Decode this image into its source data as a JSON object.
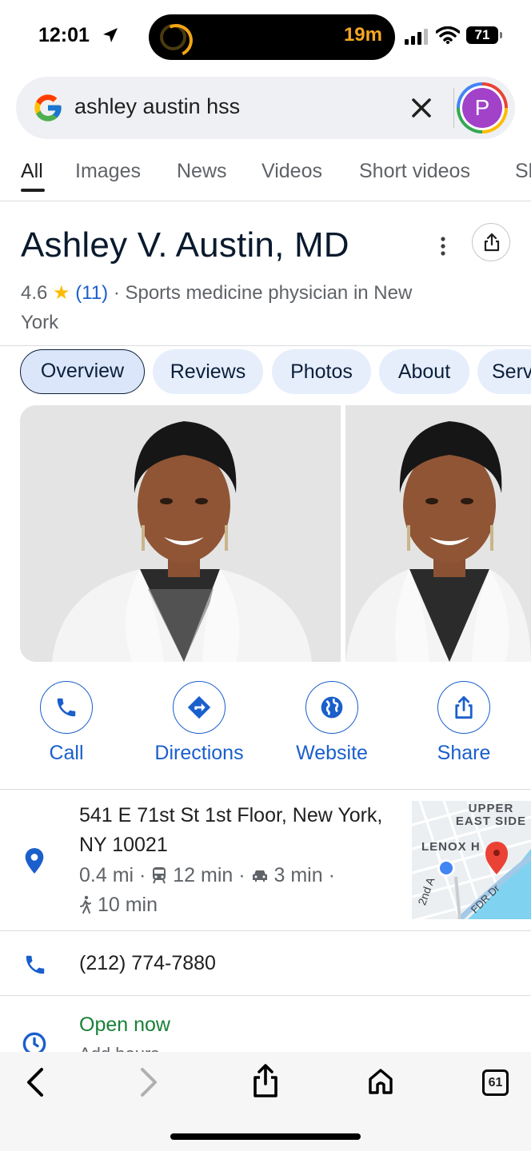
{
  "status_bar": {
    "time": "12:01",
    "timer": "19m",
    "battery": "71"
  },
  "search": {
    "query": "ashley austin hss",
    "avatar_letter": "P"
  },
  "result_tabs": [
    "All",
    "Images",
    "News",
    "Videos",
    "Short videos",
    "Sh"
  ],
  "place": {
    "name": "Ashley V. Austin, MD",
    "rating": "4.6",
    "star": "★",
    "review_count": "(11)",
    "category": "· Sports medicine physician in New York"
  },
  "chips": [
    "Overview",
    "Reviews",
    "Photos",
    "About",
    "Services"
  ],
  "actions": {
    "call": "Call",
    "directions": "Directions",
    "website": "Website",
    "share": "Share"
  },
  "address": {
    "line": "541 E 71st St 1st Floor, New York, NY 10021",
    "distance": "0.4 mi ·",
    "transit": "12 min ·",
    "drive": "3 min ·",
    "walk": "10 min"
  },
  "map": {
    "area_label": "UPPER EAST SIDE",
    "lenox_label": "LENOX H",
    "street1": "2nd A",
    "street2": "FDR Dr"
  },
  "phone": "(212) 774-7880",
  "hours": {
    "status": "Open now",
    "sub": "Add hours"
  },
  "toolbar": {
    "tabs_count": "61"
  },
  "colors": {
    "accent": "#1a5fcc",
    "open_green": "#188038",
    "star": "#fbbc04",
    "avatar": "#a142c9",
    "pin_red": "#ea4335"
  }
}
